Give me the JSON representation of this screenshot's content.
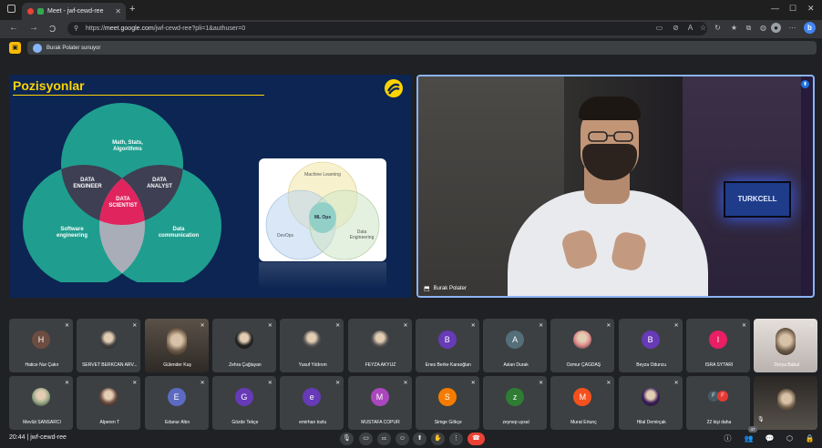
{
  "browser": {
    "tab_title": "Meet - jwf-cewd-ree",
    "url_prefix": "https://",
    "url_domain": "meet.google.com",
    "url_path": "/jwf-cewd-ree?pli=1&authuser=0",
    "new_tab": "+",
    "window_min": "—",
    "window_max": "☐",
    "window_close": "✕",
    "nav_back": "←",
    "nav_forward": "→",
    "nav_reload": "C",
    "profile_initial": "b"
  },
  "meet": {
    "presenting_text": "Burak Polater sunuyor",
    "meeting_code": "jwf-cewd-ree",
    "time": "20:44",
    "more_label": "22 kişi daha",
    "more_initials": [
      "F",
      "F"
    ],
    "participant_count": "47"
  },
  "slide": {
    "title": "Pozisyonlar",
    "venn_top": "Math, Stats, Algorithms",
    "venn_left": "Software engineering",
    "venn_right": "Data communication",
    "venn_ab": "DATA ENGINEER",
    "venn_ac": "DATA ANALYST",
    "venn_center": "DATA SCIENTIST",
    "ml_top": "Machine Learning",
    "ml_left": "DevOps",
    "ml_right": "Data Engineering",
    "ml_center": "ML Ops"
  },
  "speaker": {
    "name": "Burak Polater",
    "monitor_text": "TURKCELL"
  },
  "participants_row1": [
    {
      "name": "Hatice Nur Çakır",
      "initial": "H",
      "color": "#6d4c41",
      "type": "avatar"
    },
    {
      "name": "SERVET BERKCAN ARV...",
      "initial": "",
      "color": "#444",
      "type": "photo"
    },
    {
      "name": "Gülender Kuş",
      "initial": "",
      "color": "",
      "type": "cam"
    },
    {
      "name": "Zehra Çağlayan",
      "initial": "",
      "color": "#222",
      "type": "photo"
    },
    {
      "name": "Yusuf Yıldırım",
      "initial": "",
      "color": "#555",
      "type": "photo"
    },
    {
      "name": "FEYZA AKYUZ",
      "initial": "",
      "color": "#555",
      "type": "photo"
    },
    {
      "name": "Enes Berke Karaoğlan",
      "initial": "B",
      "color": "#673ab7",
      "type": "avatar"
    },
    {
      "name": "Aslan Durak",
      "initial": "A",
      "color": "#546e7a",
      "type": "avatar"
    },
    {
      "name": "Özmur ÇAĞDAŞ",
      "initial": "",
      "color": "#d88",
      "type": "photo"
    },
    {
      "name": "Beyza Oduncu",
      "initial": "B",
      "color": "#673ab7",
      "type": "avatar"
    },
    {
      "name": "ISRA SYTARI",
      "initial": "I",
      "color": "#e91e63",
      "type": "avatar"
    },
    {
      "name": "Derya Babul",
      "initial": "",
      "color": "",
      "type": "cam2"
    }
  ],
  "participants_row2": [
    {
      "name": "Mevlüt SANSARCI",
      "initial": "",
      "color": "#9a8",
      "type": "photo"
    },
    {
      "name": "Alperen T",
      "initial": "",
      "color": "#6d4c41",
      "type": "photo"
    },
    {
      "name": "Edanur Altın",
      "initial": "E",
      "color": "#5c6bc0",
      "type": "avatar"
    },
    {
      "name": "Gözde Tekçe",
      "initial": "G",
      "color": "#673ab7",
      "type": "avatar"
    },
    {
      "name": "emirhan tozlu",
      "initial": "e",
      "color": "#673ab7",
      "type": "avatar"
    },
    {
      "name": "MUSTAFA COPUR",
      "initial": "M",
      "color": "#ab47bc",
      "type": "avatar"
    },
    {
      "name": "Simge Gökçe",
      "initial": "S",
      "color": "#f57c00",
      "type": "avatar"
    },
    {
      "name": "zeynep uysal",
      "initial": "z",
      "color": "#2e7d32",
      "type": "avatar"
    },
    {
      "name": "Murat Ertunç",
      "initial": "M",
      "color": "#f4511e",
      "type": "avatar"
    },
    {
      "name": "Hilal Demirçak",
      "initial": "",
      "color": "#3a1d5c",
      "type": "photo"
    }
  ],
  "controls": {
    "mic": "🎙",
    "camera": "▭",
    "captions": "cc",
    "emoji": "☺",
    "present": "⬆",
    "raise_hand": "✋",
    "more": "⋮",
    "end_call": "☎",
    "info": "ⓘ",
    "people": "👥",
    "chat": "💬",
    "activities": "⬡",
    "host": "🔒"
  },
  "colors": {
    "slide_bg": "#0c2553",
    "venn_teal": "#1f9e8f",
    "venn_dark": "#3e3f52",
    "venn_center": "#e0245e",
    "accent_yellow": "#ffd400",
    "end_call": "#ea4335"
  }
}
